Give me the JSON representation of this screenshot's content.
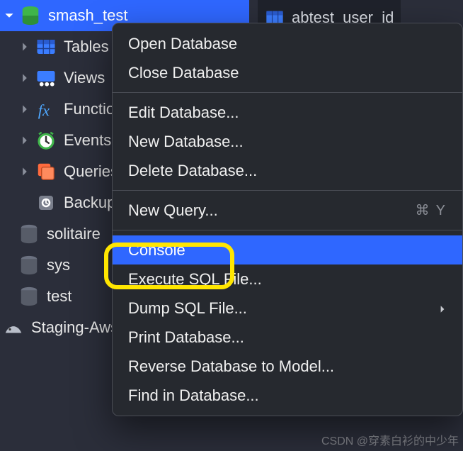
{
  "tree": {
    "root_label": "smash_test",
    "children": [
      {
        "label": "Tables",
        "icon": "table-icon"
      },
      {
        "label": "Views",
        "icon": "views-icon"
      },
      {
        "label": "Functions",
        "icon": "function-icon"
      },
      {
        "label": "Events",
        "icon": "clock-icon"
      },
      {
        "label": "Queries",
        "icon": "queries-icon"
      },
      {
        "label": "Backups",
        "icon": "backup-icon"
      }
    ],
    "siblings": [
      {
        "label": "solitaire"
      },
      {
        "label": "sys"
      },
      {
        "label": "test"
      }
    ],
    "connection_label": "Staging-Aws"
  },
  "tabs": {
    "first_tab_label": "abtest_user_id"
  },
  "context_menu": {
    "groups": [
      [
        {
          "label": "Open Database"
        },
        {
          "label": "Close Database"
        }
      ],
      [
        {
          "label": "Edit Database..."
        },
        {
          "label": "New Database..."
        },
        {
          "label": "Delete Database..."
        }
      ],
      [
        {
          "label": "New Query...",
          "shortcut": "⌘ Y"
        }
      ],
      [
        {
          "label": "Console",
          "highlighted": true
        },
        {
          "label": "Execute SQL File..."
        },
        {
          "label": "Dump SQL File...",
          "submenu": true
        },
        {
          "label": "Print Database..."
        },
        {
          "label": "Reverse Database to Model..."
        },
        {
          "label": "Find in Database..."
        }
      ]
    ]
  },
  "watermark": "CSDN @穿素白衫的中少年",
  "colors": {
    "selection": "#2f67ff",
    "menu_bg": "#26292f",
    "accent_yellow": "#ffe600"
  }
}
